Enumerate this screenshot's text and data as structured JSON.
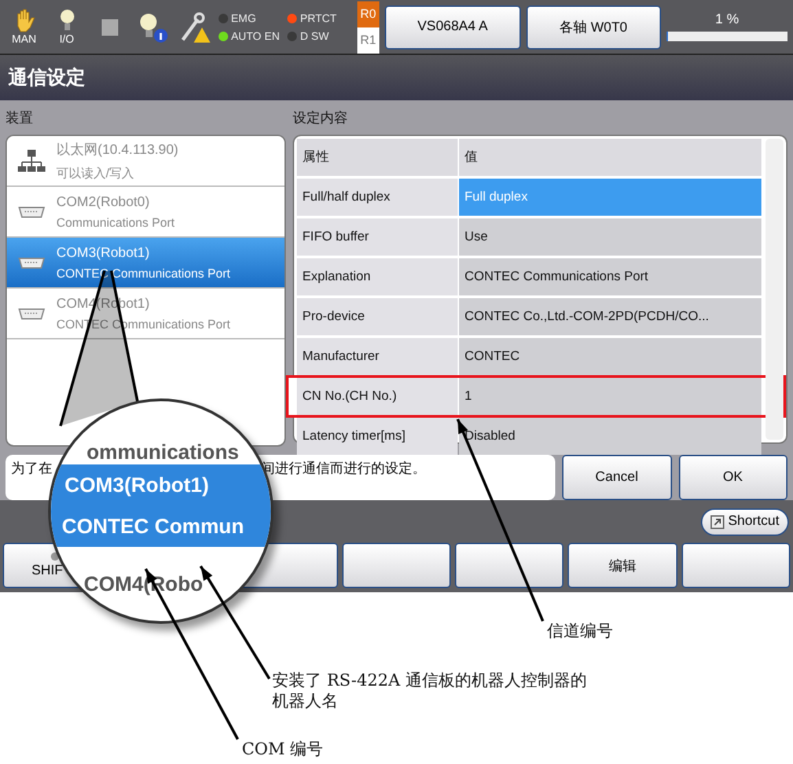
{
  "status_bar": {
    "indicators": [
      {
        "kind": "hand",
        "label": "MAN"
      },
      {
        "kind": "bulb",
        "label": "I/O"
      },
      {
        "kind": "square"
      },
      {
        "kind": "bulb-info"
      },
      {
        "kind": "wrench-warning"
      }
    ],
    "leds": [
      {
        "label": "EMG",
        "color": "#3a3a3a"
      },
      {
        "label": "AUTO EN",
        "color": "#6fdc1e"
      },
      {
        "label": "PRTCT",
        "color": "#ff4a12"
      },
      {
        "label": "D SW",
        "color": "#3a3a3a"
      }
    ],
    "robots": [
      {
        "label": "R0",
        "selected": true
      },
      {
        "label": "R1",
        "selected": false
      }
    ],
    "buttons": [
      "VS068A4 A",
      "各轴 W0T0"
    ],
    "speed": {
      "reading": "1 %",
      "level": 0.01
    }
  },
  "window": {
    "title": "通信设定"
  },
  "devices": {
    "label": "装置",
    "items": [
      {
        "kind": "network",
        "name": "以太网(10.4.113.90)",
        "detail": "可以读入/写入",
        "selected": false
      },
      {
        "kind": "serial",
        "name": "COM2(Robot0)",
        "detail": "Communications Port",
        "selected": false
      },
      {
        "kind": "serial",
        "name": "COM3(Robot1)",
        "detail": "CONTEC Communications Port",
        "selected": true
      },
      {
        "kind": "serial",
        "name": "COM4(Robot1)",
        "detail": "CONTEC Communications Port",
        "selected": false
      }
    ]
  },
  "settings": {
    "label": "设定内容",
    "columns": [
      "属性",
      "值"
    ],
    "rows": [
      {
        "property": "Full/half duplex",
        "value": "Full duplex",
        "selected": true,
        "highlighted": false
      },
      {
        "property": "FIFO buffer",
        "value": "Use",
        "selected": false,
        "highlighted": false
      },
      {
        "property": "Explanation",
        "value": "CONTEC Communications Port",
        "selected": false,
        "highlighted": false
      },
      {
        "property": "Pro-device",
        "value": "CONTEC Co.,Ltd.-COM-2PD(PCDH/CO...",
        "selected": false,
        "highlighted": false
      },
      {
        "property": "Manufacturer",
        "value": "CONTEC",
        "selected": false,
        "highlighted": false
      },
      {
        "property": "CN No.(CH No.)",
        "value": "1",
        "selected": false,
        "highlighted": true
      },
      {
        "property": "Latency timer[ms]",
        "value": "Disabled",
        "selected": false,
        "highlighted": false
      }
    ]
  },
  "message": {
    "parts": [
      "为了在",
      "间进行通信而进行的设定。"
    ]
  },
  "dialog_buttons": [
    "Cancel",
    "OK"
  ],
  "shortcut": "Shortcut",
  "function_keys": [
    {
      "kind": "shift",
      "label": "SHIF",
      "lamp_on": false
    },
    {
      "kind": "blank"
    },
    {
      "kind": "blank"
    },
    {
      "kind": "blank"
    },
    {
      "kind": "key",
      "label": "编辑"
    },
    {
      "kind": "blank"
    }
  ],
  "magnifier": {
    "lines": [
      {
        "text": "ommunications",
        "selected": false
      },
      {
        "text": "COM3(Robot1)",
        "selected": true
      },
      {
        "text": "CONTEC Commun",
        "selected": true
      },
      {
        "text": "COM4(Robo",
        "selected": false
      }
    ]
  },
  "annotations": [
    {
      "kind": "channel",
      "text": "信道编号"
    },
    {
      "kind": "robot",
      "text": "安装了 RS-422A 通信板的机器人控制器的机器人名"
    },
    {
      "kind": "com",
      "text": "COM 编号"
    }
  ]
}
